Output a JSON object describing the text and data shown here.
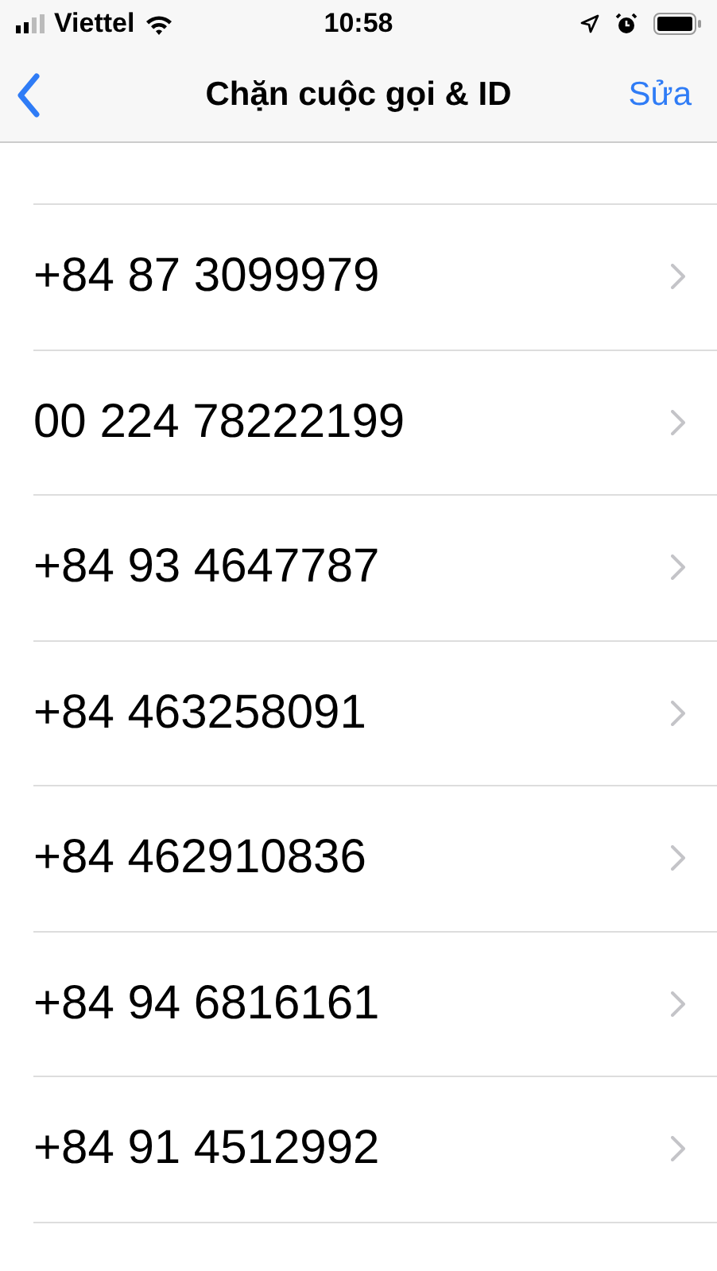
{
  "status_bar": {
    "carrier": "Viettel",
    "time": "10:58"
  },
  "nav_bar": {
    "title": "Chặn cuộc gọi & ID",
    "edit": "Sửa"
  },
  "numbers": [
    "+84 87 3099979",
    "00 224 78222199",
    "+84 93 4647787",
    "+84 463258091",
    "+84 462910836",
    "+84 94 6816161",
    "+84 91 4512992"
  ]
}
